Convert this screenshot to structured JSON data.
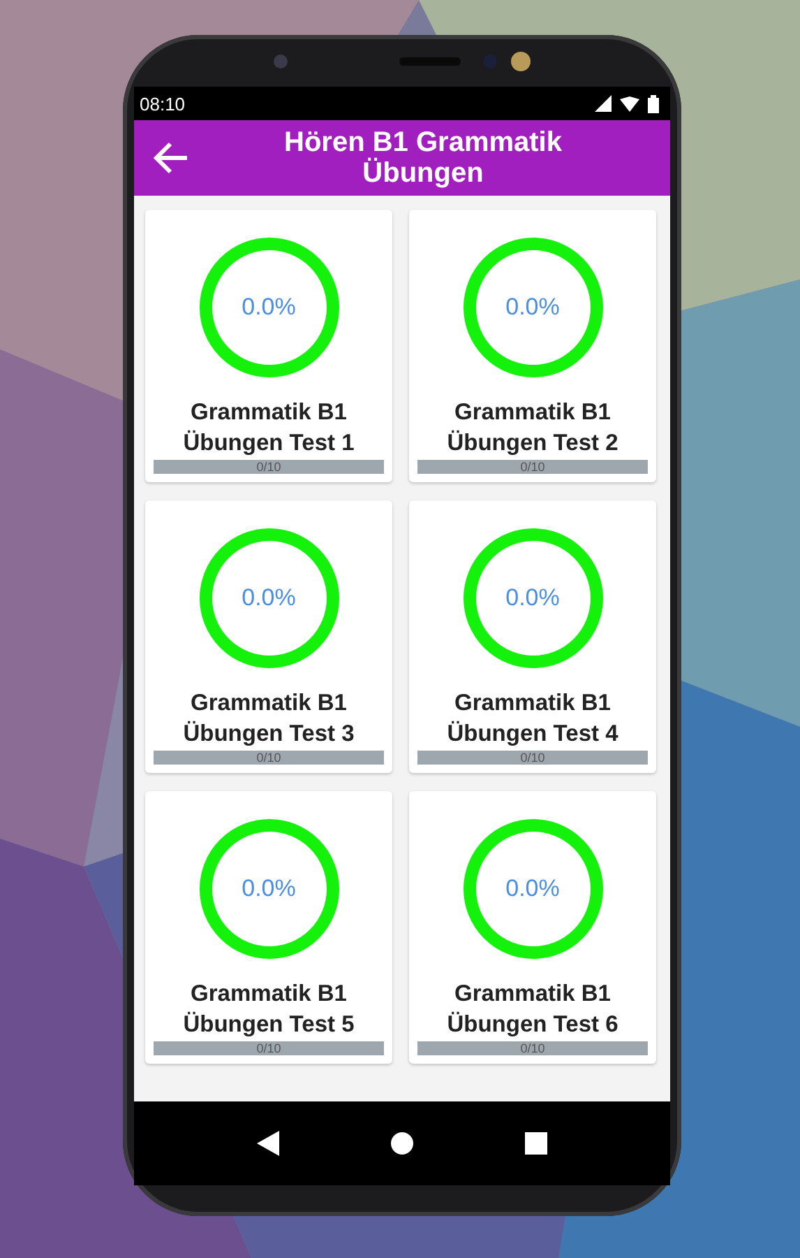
{
  "status_bar": {
    "time": "08:10"
  },
  "app_bar": {
    "title": "Hören B1 Grammatik Übungen"
  },
  "tests": [
    {
      "percent": "0.0%",
      "title": "Grammatik B1 Übungen Test 1",
      "score": "0/10",
      "level": 0
    },
    {
      "percent": "0.0%",
      "title": "Grammatik B1 Übungen Test 2",
      "score": "0/10",
      "level": 0
    },
    {
      "percent": "0.0%",
      "title": "Grammatik B1 Übungen Test 3",
      "score": "0/10",
      "level": 0
    },
    {
      "percent": "0.0%",
      "title": "Grammatik B1 Übungen Test 4",
      "score": "0/10",
      "level": 0
    },
    {
      "percent": "0.0%",
      "title": "Grammatik B1 Übungen Test 5",
      "score": "0/10",
      "level": 0
    },
    {
      "percent": "0.0%",
      "title": "Grammatik B1 Übungen Test 6",
      "score": "0/10",
      "level": 0
    }
  ]
}
